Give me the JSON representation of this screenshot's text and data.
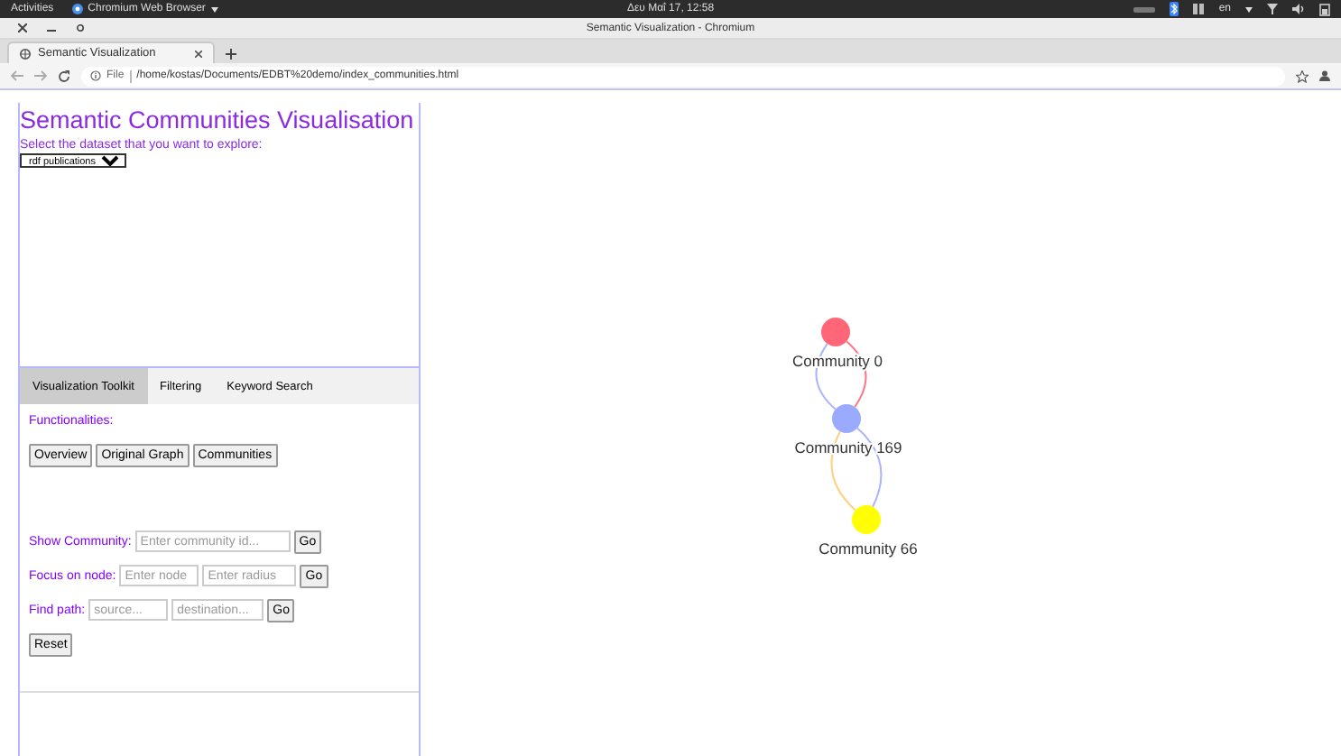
{
  "system_bar": {
    "activities": "Activities",
    "app_menu": "Chromium Web Browser",
    "clock": "Δευ Μαΐ 17, 12:58",
    "keyboard_layout": "en"
  },
  "window": {
    "title": "Semantic Visualization - Chromium"
  },
  "tabs": [
    {
      "label": "Semantic Visualization",
      "selected": true
    }
  ],
  "address_bar": {
    "scheme": "File",
    "url": "/home/kostas/Documents/EDBT%20demo/index_communities.html"
  },
  "sidebar": {
    "title": "Semantic Communities Visualisation",
    "dataset_prompt": "Select the dataset that you want to explore:",
    "dataset": "rdf publications",
    "tabs": [
      {
        "label": "Visualization Toolkit",
        "selected": true
      },
      {
        "label": "Filtering",
        "selected": false
      },
      {
        "label": "Keyword Search",
        "selected": false
      }
    ],
    "functionalities_label": "Functionalities:",
    "view_buttons": [
      "Overview",
      "Original Graph",
      "Communities"
    ],
    "forms": [
      {
        "label": "Show Community:",
        "fields": [
          {
            "placeholder": "Enter community id..."
          }
        ],
        "button": "Go"
      },
      {
        "label": "Focus on node:",
        "fields": [
          {
            "placeholder": "Enter node"
          },
          {
            "placeholder": "Enter radius"
          }
        ],
        "button": "Go"
      },
      {
        "label": "Find path:",
        "fields": [
          {
            "placeholder": "source..."
          },
          {
            "placeholder": "destination..."
          }
        ],
        "button": "Go"
      }
    ],
    "reset_button": "Reset"
  },
  "graph": {
    "nodes": [
      {
        "label": "Community 0",
        "color": "#ff6677"
      },
      {
        "label": "Community 169",
        "color": "#99aaff"
      },
      {
        "label": "Community 66",
        "color": "#ffff00"
      }
    ],
    "edges": [
      {
        "color": "#aab4ff"
      },
      {
        "color": "#ff7788"
      },
      {
        "color": "#ffd080"
      },
      {
        "color": "#aab4ff"
      }
    ]
  }
}
